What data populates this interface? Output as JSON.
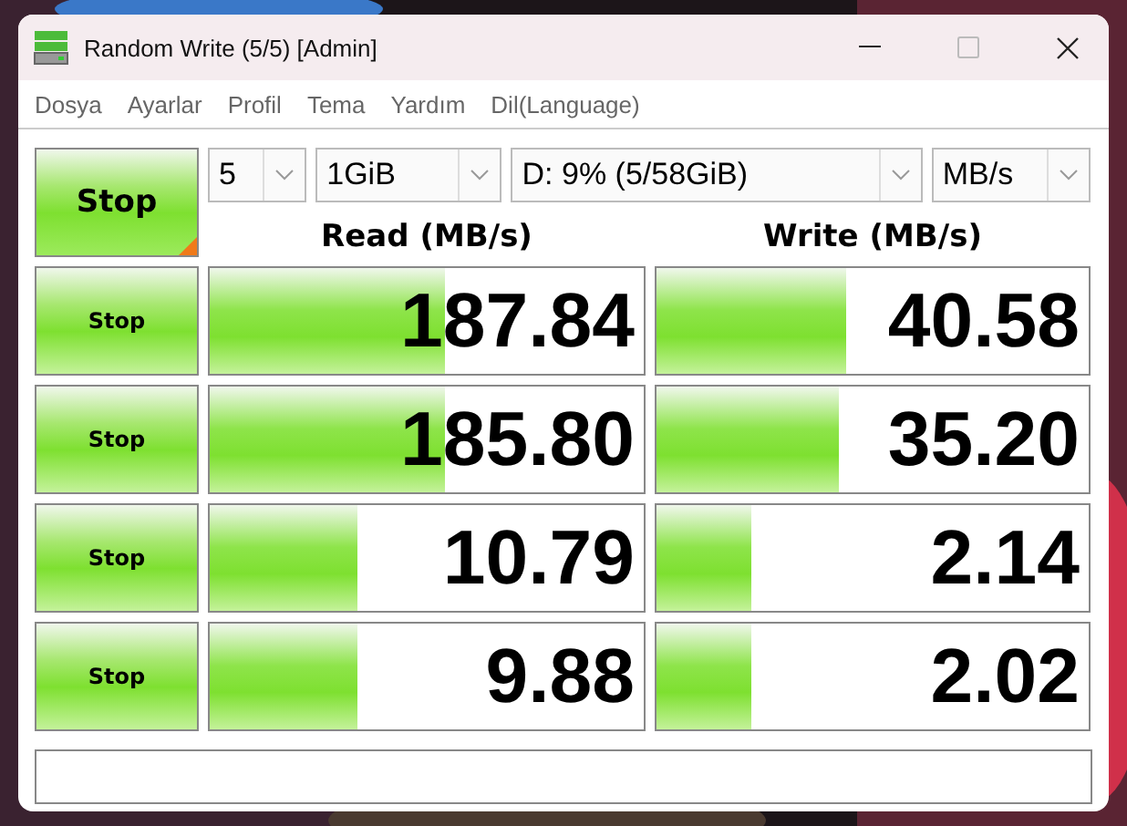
{
  "window": {
    "title": "Random Write (5/5) [Admin]"
  },
  "menu": [
    "Dosya",
    "Ayarlar",
    "Profil",
    "Tema",
    "Yardım",
    "Dil(Language)"
  ],
  "main_button": {
    "label": "Stop"
  },
  "selectors": [
    {
      "value": "5"
    },
    {
      "value": "1GiB"
    },
    {
      "value": "D: 9% (5/58GiB)"
    },
    {
      "value": "MB/s"
    }
  ],
  "headers": {
    "read": "Read (MB/s)",
    "write": "Write (MB/s)"
  },
  "rows": [
    {
      "button": "Stop",
      "read": {
        "value": "187.84",
        "level": 0.54
      },
      "write": {
        "value": "40.58",
        "level": 0.44
      }
    },
    {
      "button": "Stop",
      "read": {
        "value": "185.80",
        "level": 0.54
      },
      "write": {
        "value": "35.20",
        "level": 0.42
      }
    },
    {
      "button": "Stop",
      "read": {
        "value": "10.79",
        "level": 0.34
      },
      "write": {
        "value": "2.14",
        "level": 0.22
      }
    },
    {
      "button": "Stop",
      "read": {
        "value": "9.88",
        "level": 0.34
      },
      "write": {
        "value": "2.02",
        "level": 0.22
      }
    }
  ]
}
